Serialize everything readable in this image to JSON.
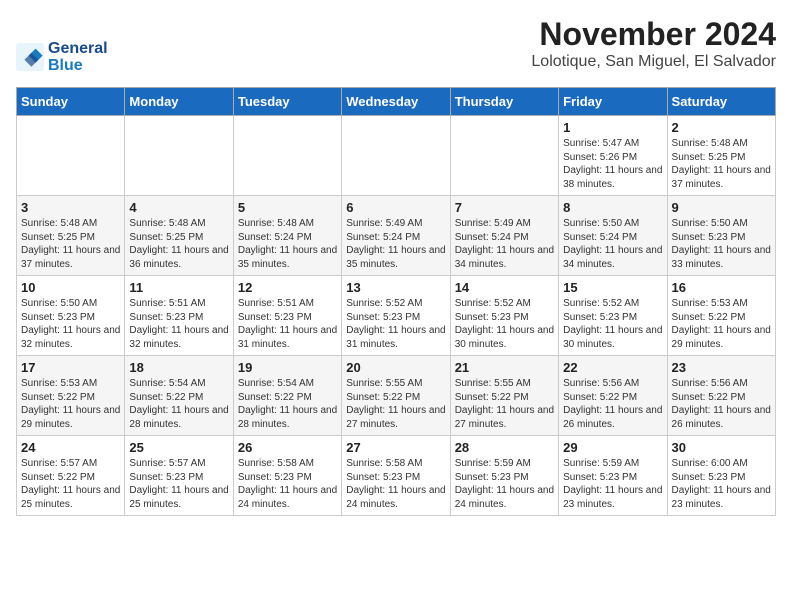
{
  "logo": {
    "line1": "General",
    "line2": "Blue"
  },
  "header": {
    "month": "November 2024",
    "location": "Lolotique, San Miguel, El Salvador"
  },
  "weekdays": [
    "Sunday",
    "Monday",
    "Tuesday",
    "Wednesday",
    "Thursday",
    "Friday",
    "Saturday"
  ],
  "weeks": [
    [
      {
        "day": "",
        "info": ""
      },
      {
        "day": "",
        "info": ""
      },
      {
        "day": "",
        "info": ""
      },
      {
        "day": "",
        "info": ""
      },
      {
        "day": "",
        "info": ""
      },
      {
        "day": "1",
        "info": "Sunrise: 5:47 AM\nSunset: 5:26 PM\nDaylight: 11 hours and 38 minutes."
      },
      {
        "day": "2",
        "info": "Sunrise: 5:48 AM\nSunset: 5:25 PM\nDaylight: 11 hours and 37 minutes."
      }
    ],
    [
      {
        "day": "3",
        "info": "Sunrise: 5:48 AM\nSunset: 5:25 PM\nDaylight: 11 hours and 37 minutes."
      },
      {
        "day": "4",
        "info": "Sunrise: 5:48 AM\nSunset: 5:25 PM\nDaylight: 11 hours and 36 minutes."
      },
      {
        "day": "5",
        "info": "Sunrise: 5:48 AM\nSunset: 5:24 PM\nDaylight: 11 hours and 35 minutes."
      },
      {
        "day": "6",
        "info": "Sunrise: 5:49 AM\nSunset: 5:24 PM\nDaylight: 11 hours and 35 minutes."
      },
      {
        "day": "7",
        "info": "Sunrise: 5:49 AM\nSunset: 5:24 PM\nDaylight: 11 hours and 34 minutes."
      },
      {
        "day": "8",
        "info": "Sunrise: 5:50 AM\nSunset: 5:24 PM\nDaylight: 11 hours and 34 minutes."
      },
      {
        "day": "9",
        "info": "Sunrise: 5:50 AM\nSunset: 5:23 PM\nDaylight: 11 hours and 33 minutes."
      }
    ],
    [
      {
        "day": "10",
        "info": "Sunrise: 5:50 AM\nSunset: 5:23 PM\nDaylight: 11 hours and 32 minutes."
      },
      {
        "day": "11",
        "info": "Sunrise: 5:51 AM\nSunset: 5:23 PM\nDaylight: 11 hours and 32 minutes."
      },
      {
        "day": "12",
        "info": "Sunrise: 5:51 AM\nSunset: 5:23 PM\nDaylight: 11 hours and 31 minutes."
      },
      {
        "day": "13",
        "info": "Sunrise: 5:52 AM\nSunset: 5:23 PM\nDaylight: 11 hours and 31 minutes."
      },
      {
        "day": "14",
        "info": "Sunrise: 5:52 AM\nSunset: 5:23 PM\nDaylight: 11 hours and 30 minutes."
      },
      {
        "day": "15",
        "info": "Sunrise: 5:52 AM\nSunset: 5:23 PM\nDaylight: 11 hours and 30 minutes."
      },
      {
        "day": "16",
        "info": "Sunrise: 5:53 AM\nSunset: 5:22 PM\nDaylight: 11 hours and 29 minutes."
      }
    ],
    [
      {
        "day": "17",
        "info": "Sunrise: 5:53 AM\nSunset: 5:22 PM\nDaylight: 11 hours and 29 minutes."
      },
      {
        "day": "18",
        "info": "Sunrise: 5:54 AM\nSunset: 5:22 PM\nDaylight: 11 hours and 28 minutes."
      },
      {
        "day": "19",
        "info": "Sunrise: 5:54 AM\nSunset: 5:22 PM\nDaylight: 11 hours and 28 minutes."
      },
      {
        "day": "20",
        "info": "Sunrise: 5:55 AM\nSunset: 5:22 PM\nDaylight: 11 hours and 27 minutes."
      },
      {
        "day": "21",
        "info": "Sunrise: 5:55 AM\nSunset: 5:22 PM\nDaylight: 11 hours and 27 minutes."
      },
      {
        "day": "22",
        "info": "Sunrise: 5:56 AM\nSunset: 5:22 PM\nDaylight: 11 hours and 26 minutes."
      },
      {
        "day": "23",
        "info": "Sunrise: 5:56 AM\nSunset: 5:22 PM\nDaylight: 11 hours and 26 minutes."
      }
    ],
    [
      {
        "day": "24",
        "info": "Sunrise: 5:57 AM\nSunset: 5:22 PM\nDaylight: 11 hours and 25 minutes."
      },
      {
        "day": "25",
        "info": "Sunrise: 5:57 AM\nSunset: 5:23 PM\nDaylight: 11 hours and 25 minutes."
      },
      {
        "day": "26",
        "info": "Sunrise: 5:58 AM\nSunset: 5:23 PM\nDaylight: 11 hours and 24 minutes."
      },
      {
        "day": "27",
        "info": "Sunrise: 5:58 AM\nSunset: 5:23 PM\nDaylight: 11 hours and 24 minutes."
      },
      {
        "day": "28",
        "info": "Sunrise: 5:59 AM\nSunset: 5:23 PM\nDaylight: 11 hours and 24 minutes."
      },
      {
        "day": "29",
        "info": "Sunrise: 5:59 AM\nSunset: 5:23 PM\nDaylight: 11 hours and 23 minutes."
      },
      {
        "day": "30",
        "info": "Sunrise: 6:00 AM\nSunset: 5:23 PM\nDaylight: 11 hours and 23 minutes."
      }
    ]
  ]
}
